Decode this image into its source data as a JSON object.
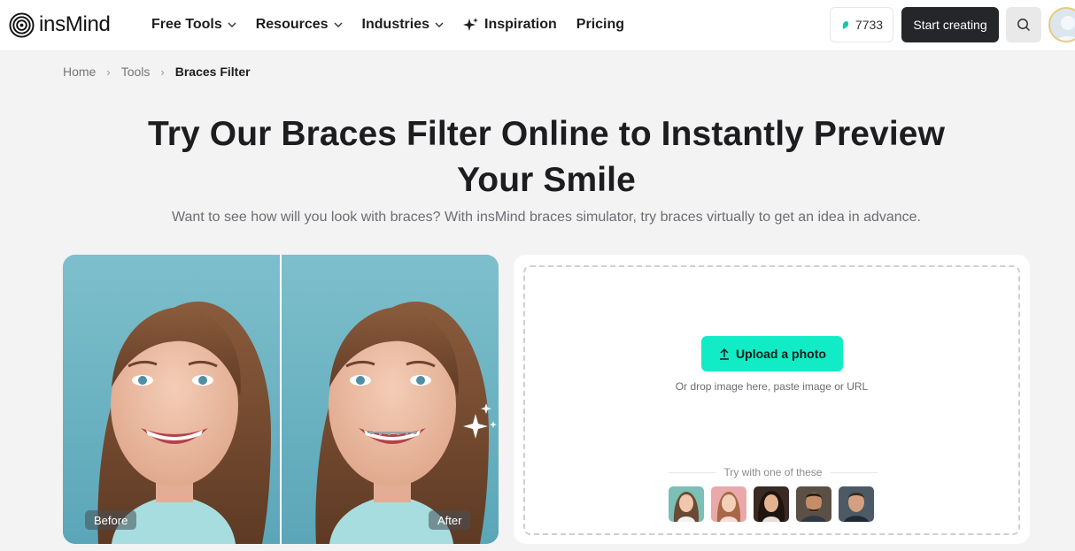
{
  "brand": {
    "name": "insMind",
    "logo_icon": "concentric-circles-logo"
  },
  "nav": {
    "items": [
      {
        "label": "Free Tools",
        "has_dropdown": true
      },
      {
        "label": "Resources",
        "has_dropdown": true
      },
      {
        "label": "Industries",
        "has_dropdown": true
      },
      {
        "label": "Inspiration",
        "has_dropdown": false,
        "icon": "sparkle-icon"
      },
      {
        "label": "Pricing",
        "has_dropdown": false
      }
    ],
    "credits": "7733",
    "start_label": "Start creating",
    "accent": "#12ecc6",
    "dark": "#24262a"
  },
  "breadcrumb": {
    "home": "Home",
    "tools": "Tools",
    "current": "Braces Filter"
  },
  "hero": {
    "title_line1": "Try Our Braces Filter Online to Instantly Preview",
    "title_line2": "Your Smile",
    "subtitle": "Want to see how will you look with braces? With insMind braces simulator, try braces virtually to get an idea in advance."
  },
  "compare": {
    "before_label": "Before",
    "after_label": "After"
  },
  "upload": {
    "button_label": "Upload a photo",
    "hint": "Or drop image here, paste image or URL",
    "try_label": "Try with one of these",
    "samples": [
      "sample-woman-1",
      "sample-woman-2",
      "sample-woman-3",
      "sample-man-1",
      "sample-man-2"
    ]
  }
}
